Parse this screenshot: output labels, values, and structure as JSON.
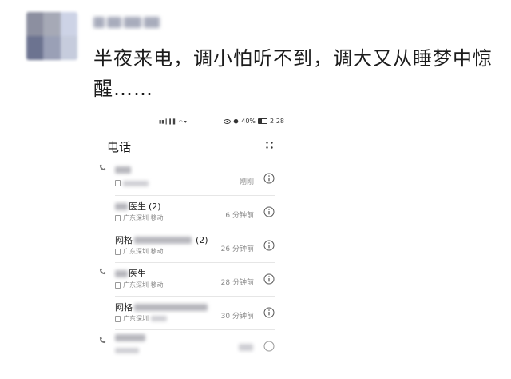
{
  "post": {
    "text": "半夜来电，调小怕听不到，调大又从睡梦中惊醒……"
  },
  "phone_screen": {
    "status_bar": {
      "battery_percent": "40%",
      "clock": "2:28"
    },
    "app_title": "电话",
    "calls": [
      {
        "name_visible": "",
        "count": "",
        "location": "",
        "time": "刚刚",
        "show_phone_icon": true
      },
      {
        "name_visible": "医生",
        "count": "(2)",
        "location": "广东深圳 移动",
        "time": "6 分钟前",
        "show_phone_icon": false
      },
      {
        "name_visible": "网格",
        "count": "(2)",
        "location": "广东深圳 移动",
        "time": "26 分钟前",
        "show_phone_icon": false
      },
      {
        "name_visible": "医生",
        "count": "",
        "location": "广东深圳 移动",
        "time": "28 分钟前",
        "show_phone_icon": true
      },
      {
        "name_visible": "网格",
        "count": "",
        "location": "广东深圳",
        "time": "30 分钟前",
        "show_phone_icon": false
      },
      {
        "name_visible": "",
        "count": "",
        "location": "",
        "time": "",
        "show_phone_icon": true
      }
    ]
  },
  "icons": {
    "call_icon": "phone-icon",
    "info_icon": "info-icon",
    "menu_icon": "more-dots-icon",
    "sim_icon": "sim-card-icon"
  }
}
